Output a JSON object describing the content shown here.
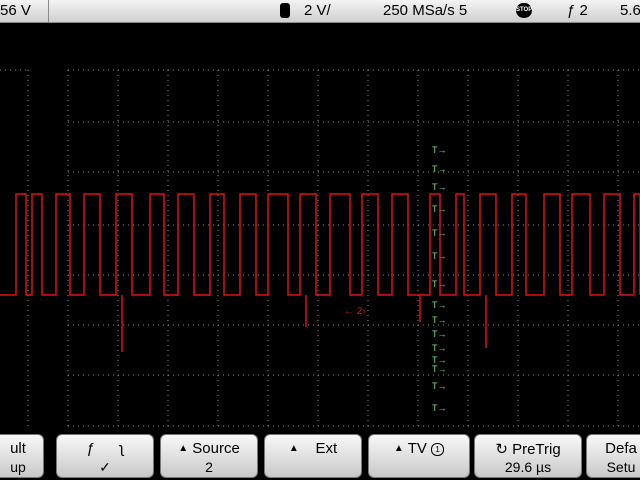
{
  "header": {
    "trigger_level_partial": "56 V",
    "channel_scale": "2 V/",
    "sample_rate": "250 MSa/s 5",
    "run_state_icon": "stop-icon",
    "trigger_edge_channel": "2",
    "trigger_partial": "5.6"
  },
  "waveform": {
    "trace_color": "#e01010",
    "grid_color": "#8a8a8a",
    "label_color": "#6fe07f",
    "trigger_marker_label": "T",
    "edge_marker_label": "2",
    "high_level_divs": 1.0,
    "low_level_divs": -1.0
  },
  "softkeys": [
    {
      "id": "fault",
      "line1": "ult",
      "line2": "up"
    },
    {
      "id": "slope",
      "line1": "",
      "line2": "✓"
    },
    {
      "id": "source",
      "line1": "Source",
      "line2": "2"
    },
    {
      "id": "ext",
      "line1": "Ext",
      "line2": ""
    },
    {
      "id": "tv",
      "line1": "TV",
      "line2": ""
    },
    {
      "id": "pretrig",
      "line1": "PreTrig",
      "line2": "29.6 µs"
    },
    {
      "id": "default",
      "line1": "Defa",
      "line2": "Setu"
    }
  ]
}
